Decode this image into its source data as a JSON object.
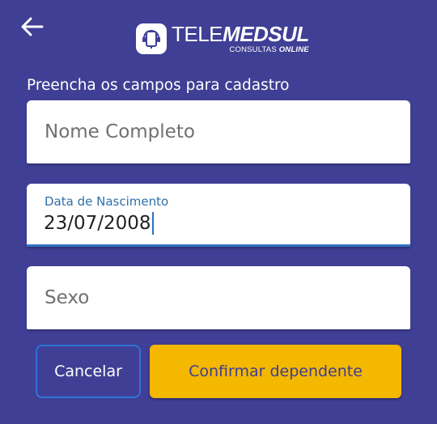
{
  "header": {
    "back_icon": "arrow-left-icon",
    "logo": {
      "main_thin": "TELE",
      "main_bold": "MEDSUL",
      "sub_thin": "CONSULTAS ",
      "sub_bold": "ONLINE",
      "badge_icon": "tablet-headset-icon"
    }
  },
  "form": {
    "instruction": "Preencha os campos para cadastro",
    "name_field": {
      "placeholder": "Nome Completo"
    },
    "birth_field": {
      "label": "Data de Nascimento",
      "value": "23/07/2008"
    },
    "sex_field": {
      "placeholder": "Sexo"
    }
  },
  "actions": {
    "cancel_label": "Cancelar",
    "confirm_label": "Confirmar dependente"
  },
  "colors": {
    "background": "#3f3f95",
    "accent": "#2e72c4",
    "confirm": "#f4b800"
  }
}
